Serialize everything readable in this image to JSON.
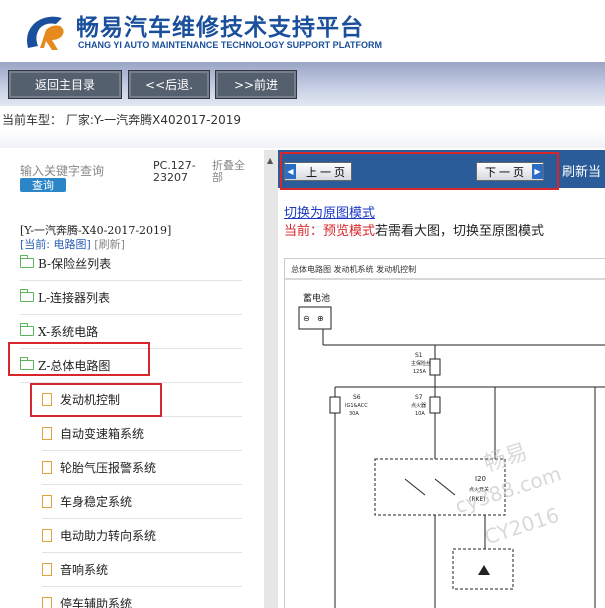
{
  "header": {
    "brand_cn": "畅易汽车维修技术支持平台",
    "brand_en": "CHANG YI AUTO MAINTENANCE TECHNOLOGY SUPPORT PLATFORM",
    "logo_color": "#1a4f9c",
    "logo_accent": "#e68a1e"
  },
  "nav": {
    "home": "返回主目录",
    "back": "<<后退.",
    "forward": ">>前进"
  },
  "vehicle_line": "当前车型： 厂家:Y-一汽奔腾X402017-2019",
  "left": {
    "search_placeholder": "输入关键字查询",
    "search_button": "查询",
    "pc_code": "PC.127-23207",
    "collapse_all": "折叠全部",
    "path": "[Y-一汽奔腾-X40-2017-2019]",
    "current_label": "[当前: 电路图]",
    "refresh_label": "[刷新]",
    "tree": [
      {
        "label": "B-保险丝列表",
        "type": "folder"
      },
      {
        "label": "L-连接器列表",
        "type": "folder"
      },
      {
        "label": "X-系统电路",
        "type": "folder"
      },
      {
        "label": "Z-总体电路图",
        "type": "folder-open"
      },
      {
        "label": "发动机控制",
        "type": "page"
      },
      {
        "label": "自动变速箱系统",
        "type": "page"
      },
      {
        "label": "轮胎气压报警系统",
        "type": "page"
      },
      {
        "label": "车身稳定系统",
        "type": "page"
      },
      {
        "label": "电动助力转向系统",
        "type": "page"
      },
      {
        "label": "音响系统",
        "type": "page"
      },
      {
        "label": "停车辅助系统",
        "type": "page"
      }
    ]
  },
  "right": {
    "prev_page": "上一页",
    "next_page": "下一页",
    "refresh_now": "刷新当",
    "switch_link": "切换为原图模式",
    "mode_current": "当前：",
    "mode_name": "预览模式",
    "mode_hint": "若需看大图，切换至原图模式",
    "diagram": {
      "breadcrumb": "总体电路图  发动机系统  发动机控制",
      "battery": "蓄电池",
      "s1": "S1",
      "s1_name": "主保险丝",
      "s1_amp": "125A",
      "s6": "S6",
      "s6_name": "IG1&ACC",
      "s6_amp": "30A",
      "s7": "S7",
      "s7_name": "点火器",
      "s7_amp": "10A",
      "i20": "I20",
      "i20_name": "点火开关",
      "rke": "(RKE)",
      "watermark1": "畅易",
      "watermark2": "cy388.com",
      "watermark3": "CY2016"
    }
  }
}
